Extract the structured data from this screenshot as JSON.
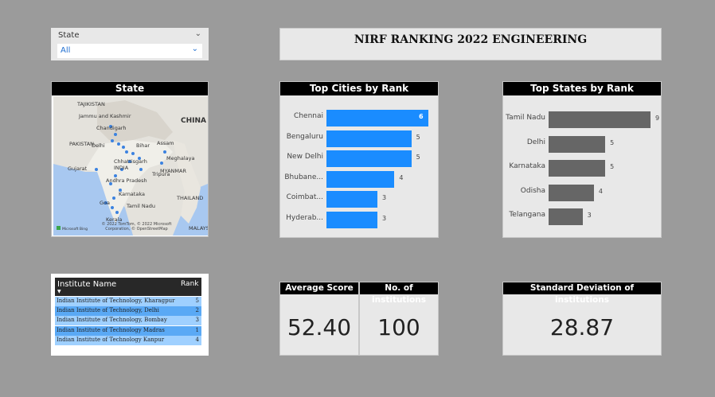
{
  "slicer": {
    "label": "State",
    "value": "All"
  },
  "title": "NIRF RANKING 2022 ENGINEERING",
  "map": {
    "header": "State",
    "labels": [
      "TAJIKISTAN",
      "Jammu and Kashmir",
      "CHINA",
      "Chandigarh",
      "PAKISTAN",
      "Delhi",
      "Bihar",
      "Assam",
      "Gujarat",
      "Chhattisgarh",
      "Meghalaya",
      "INDIA",
      "Tripura",
      "MYANMAR",
      "Andhra Pradesh",
      "Karnataka",
      "THAILAND",
      "Goa",
      "Tamil Nadu",
      "Kerala",
      "MALAYSIA"
    ],
    "attribution": "© 2022 TomTom, © 2022 Microsoft Corporation, © OpenStreetMap",
    "brand": "Microsoft Bing"
  },
  "top_cities": {
    "header": "Top Cities by Rank",
    "bar_color": "#1a8cff",
    "chart_data": {
      "type": "bar",
      "categories": [
        "Chennai",
        "Bengaluru",
        "New Delhi",
        "Bhubane...",
        "Coimbat...",
        "Hyderab..."
      ],
      "values": [
        6,
        5,
        5,
        4,
        3,
        3
      ],
      "xlim": [
        0,
        6
      ]
    }
  },
  "top_states": {
    "header": "Top States by Rank",
    "bar_color": "#666666",
    "chart_data": {
      "type": "bar",
      "categories": [
        "Tamil Nadu",
        "Delhi",
        "Karnataka",
        "Odisha",
        "Telangana"
      ],
      "values": [
        9,
        5,
        5,
        4,
        3
      ],
      "xlim": [
        0,
        9
      ]
    }
  },
  "table": {
    "col_name": "Institute Name",
    "col_rank": "Rank",
    "rows": [
      {
        "name": "Indian Institute of Technology, Kharagpur",
        "rank": "5"
      },
      {
        "name": "Indian Institute of Technology, Delhi",
        "rank": "2"
      },
      {
        "name": "Indian Institute of Technology, Bombay",
        "rank": "3"
      },
      {
        "name": "Indian Institute of Technology Madras",
        "rank": "1"
      },
      {
        "name": "Indian Institute of Technology Kanpur",
        "rank": "4"
      }
    ],
    "row_colors": [
      "#9fd0ff",
      "#5aa9f5",
      "#9fd0ff",
      "#5aa9f5",
      "#9fd0ff"
    ]
  },
  "kpis": {
    "avg_label": "Average Score",
    "avg_value": "52.40",
    "noi_label": "No. of institutions",
    "noi_value": "100",
    "std_label": "Standard Deviation of institutions",
    "std_value": "28.87"
  }
}
